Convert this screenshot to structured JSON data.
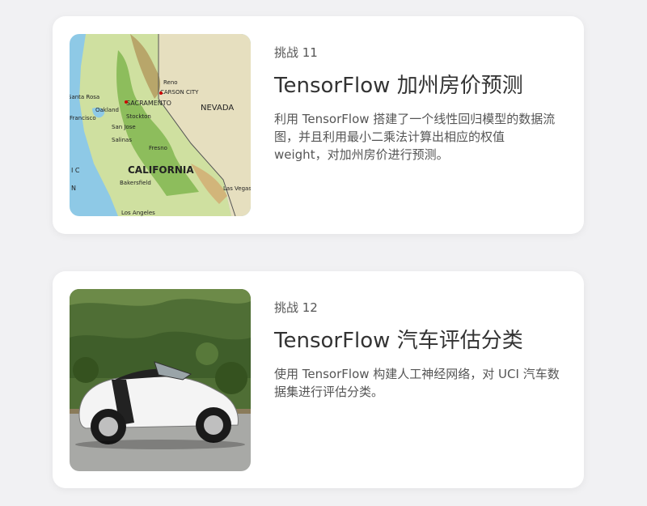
{
  "cards": [
    {
      "challenge_label": "挑战 11",
      "title": "TensorFlow 加州房价预测",
      "description": "利用 TensorFlow 搭建了一个线性回归模型的数据流图，并且利用最小二乘法计算出相应的权值 weight，对加州房价进行预测。",
      "image": {
        "labels": {
          "reno": "Reno",
          "carson_city": "CARSON CITY",
          "santa_rosa": "Santa Rosa",
          "sacramento": "SACRAMENTO",
          "nevada": "NEVADA",
          "oakland": "Oakland",
          "francisco": "Francisco",
          "stockton": "Stockton",
          "san_jose": "San Jose",
          "salinas": "Salinas",
          "fresno": "Fresno",
          "california": "CALIFORNIA",
          "bakersfield": "Bakersfield",
          "las_vegas": "Las Vegas",
          "los_angeles": "Los Angeles",
          "ocean_ic": "I C",
          "ocean_n": "N"
        }
      }
    },
    {
      "challenge_label": "挑战 12",
      "title": "TensorFlow 汽车评估分类",
      "description": "使用 TensorFlow 构建人工神经网络，对 UCI 汽车数据集进行评估分类。",
      "image": {}
    }
  ]
}
